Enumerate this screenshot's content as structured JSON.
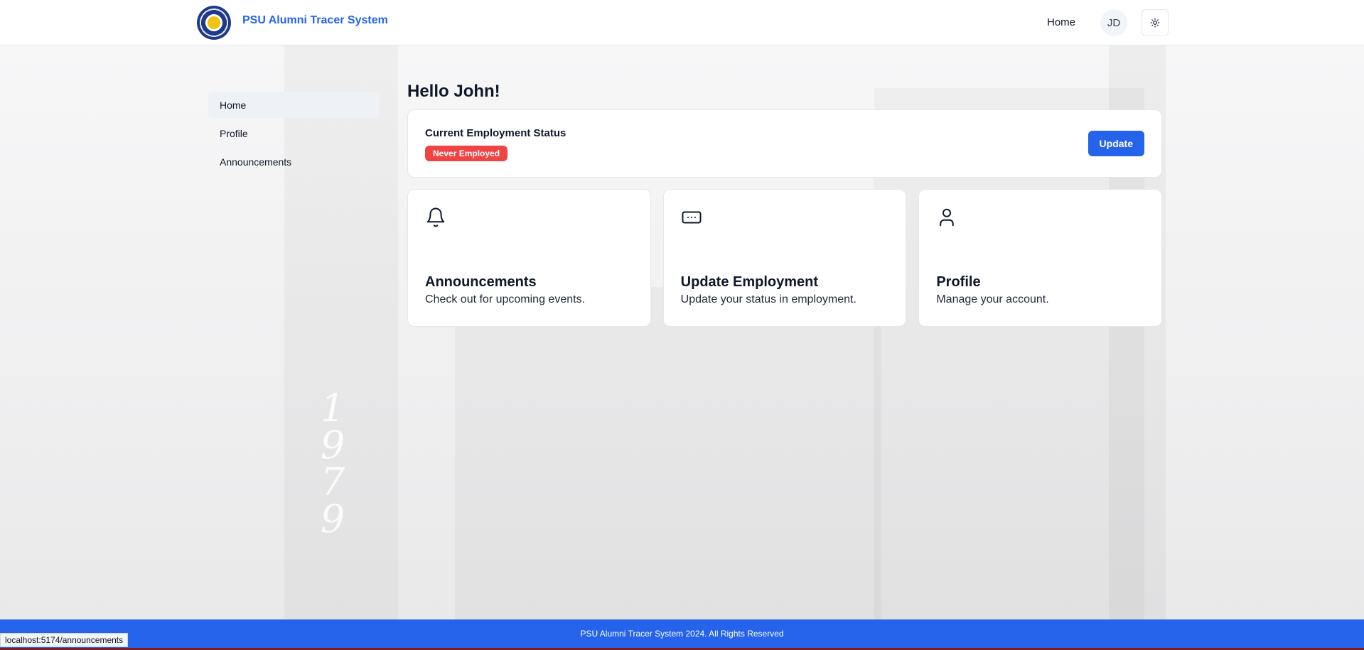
{
  "header": {
    "brand": "PSU Alumni Tracer System",
    "nav_home": "Home",
    "avatar_initials": "JD"
  },
  "sidebar": {
    "items": [
      {
        "label": "Home",
        "active": true
      },
      {
        "label": "Profile",
        "active": false
      },
      {
        "label": "Announcements",
        "active": false
      }
    ]
  },
  "main": {
    "greeting": "Hello John!",
    "status": {
      "title": "Current Employment Status",
      "badge": "Never Employed",
      "badge_color": "#ef4444",
      "update_label": "Update"
    },
    "cards": [
      {
        "icon": "bell-icon",
        "title": "Announcements",
        "desc": "Check out for upcoming events."
      },
      {
        "icon": "message-dots-icon",
        "title": "Update Employment",
        "desc": "Update your status in employment."
      },
      {
        "icon": "user-icon",
        "title": "Profile",
        "desc": "Manage your account."
      }
    ]
  },
  "background": {
    "building_text": "1979"
  },
  "footer": {
    "text": "PSU Alumni Tracer System 2024. All Rights Reserved"
  },
  "browser": {
    "status_url": "localhost:5174/announcements"
  },
  "colors": {
    "accent": "#2563eb",
    "danger": "#ef4444"
  }
}
